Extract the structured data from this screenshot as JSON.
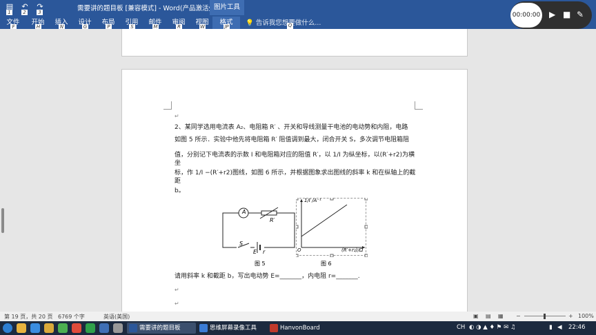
{
  "window": {
    "title": "需要讲的题目板 [兼容模式] - Word(产品激活失败)",
    "contextual_tab": "图片工具",
    "qat_keys": [
      "1",
      "2",
      "3"
    ]
  },
  "ribbon": {
    "tabs": [
      {
        "label": "文件",
        "key": "F"
      },
      {
        "label": "开始",
        "key": "H"
      },
      {
        "label": "插入",
        "key": "N"
      },
      {
        "label": "设计",
        "key": "G"
      },
      {
        "label": "布局",
        "key": "P"
      },
      {
        "label": "引用",
        "key": "S"
      },
      {
        "label": "邮件",
        "key": "M"
      },
      {
        "label": "审阅",
        "key": "R"
      },
      {
        "label": "视图",
        "key": "W"
      },
      {
        "label": "格式",
        "key": "JP"
      }
    ],
    "tell_me": "告诉我您想要做什么...",
    "tell_me_key": "Q"
  },
  "recorder": {
    "time": "00:00:00"
  },
  "document": {
    "question_lines": [
      "2、某同学选用电流表 A₂、电阻箱 R′ 、开关和导线测量干电池的电动势和内阻，电路",
      "如图 5 所示．实验中他先将电阻箱 R′ 阻值调到最大，闭合开关 S，多次调节电阻箱阻",
      "值，分别记下电流表的示数 I 和电阻箱对应的阻值 R′，以 1/I 为纵坐标，以(R′+r2)为横坐",
      "标，作 1/I −(R′+r2)图线，如图 6 所示，并根据图象求出图线的斜率 k 和在纵轴上的截距",
      "b。"
    ],
    "fig5_caption": "图 5",
    "fig6_caption": "图 6",
    "circuit_labels": {
      "ammeter": "A",
      "resistor": "R′",
      "switch": "S",
      "emf": "E",
      "r": "r"
    },
    "graph_labels": {
      "y_axis": "1/I /A⁻¹",
      "x_axis": "(R′+r₂)/Ω",
      "origin": "O"
    },
    "answer_line": "请用斜率 k 和截距 b，写出电动势 E=_______，内电阻 r=_______."
  },
  "statusbar": {
    "page": "第 19 页，共 20 页",
    "words": "6769 个字",
    "language": "英语(美国)",
    "zoom": "100%"
  },
  "taskbar": {
    "items": [
      {
        "label": "需要讲的题目板 [兼...",
        "color": "#2b579a"
      },
      {
        "label": "思维屏幕录像工具",
        "color": "#3a7bd5"
      },
      {
        "label": "HanvonBoard",
        "color": "#c0392b"
      }
    ],
    "ime": "CH",
    "clock": "22:46"
  },
  "colors": {
    "word_blue": "#2b579a",
    "taskbar": "#1c2a3f"
  }
}
